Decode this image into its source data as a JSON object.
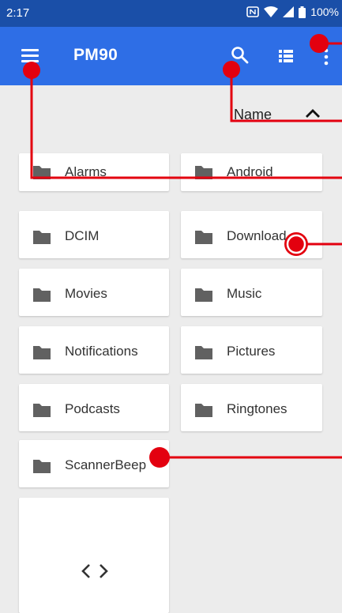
{
  "status": {
    "time": "2:17",
    "battery": "100%"
  },
  "appbar": {
    "title": "PM90"
  },
  "sort": {
    "label": "Name"
  },
  "folders": [
    "Alarms",
    "Android",
    "DCIM",
    "Download",
    "Movies",
    "Music",
    "Notifications",
    "Pictures",
    "Podcasts",
    "Ringtones",
    "ScannerBeep"
  ],
  "colors": {
    "statusbar": "#1a4fa8",
    "appbar": "#2e6ee6",
    "background": "#ececec",
    "annotation": "#e3000f"
  }
}
